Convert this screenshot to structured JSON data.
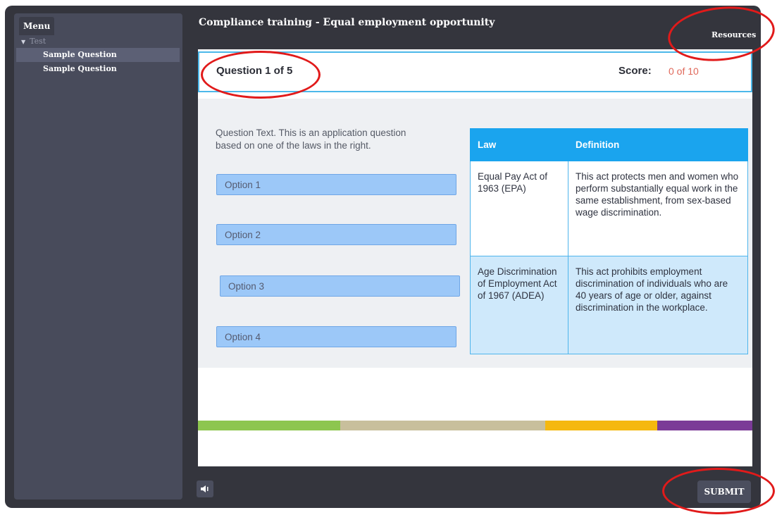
{
  "sidebar": {
    "menu_tab": "Menu",
    "tree": {
      "parent_label": "Test",
      "items": [
        {
          "label": "Sample Question",
          "active": true
        },
        {
          "label": "Sample Question",
          "active": false
        }
      ]
    }
  },
  "header": {
    "course_title": "Compliance training - Equal employment opportunity",
    "resources_label": "Resources"
  },
  "question_bar": {
    "question_counter": "Question 1 of 5",
    "score_label": "Score:",
    "score_value": "0 of 10"
  },
  "question": {
    "text": "Question Text. This is an application question based on one of the laws in the right.",
    "options": [
      "Option 1",
      "Option 2",
      "Option 3",
      "Option 4"
    ]
  },
  "law_table": {
    "headers": [
      "Law",
      "Definition"
    ],
    "rows": [
      {
        "law": "Equal Pay Act of 1963 (EPA)",
        "definition": "This act protects men and women who perform substantially equal work in the same establishment, from sex-based wage discrimination."
      },
      {
        "law": "Age Discrimination of Employment Act of 1967 (ADEA)",
        "definition": "This act prohibits employment discrimination of individuals who are 40 years of age or older, against discrimination in the workplace."
      }
    ]
  },
  "progress_stripe_colors": [
    "#8dc64f",
    "#c8bf9c",
    "#f5b80f",
    "#7b3b97"
  ],
  "footer": {
    "audio_icon": "speaker-icon",
    "submit_label": "SUBMIT"
  },
  "colors": {
    "accent": "#1aa4ee",
    "score": "#e0685a",
    "annotation": "#e11a1a"
  }
}
